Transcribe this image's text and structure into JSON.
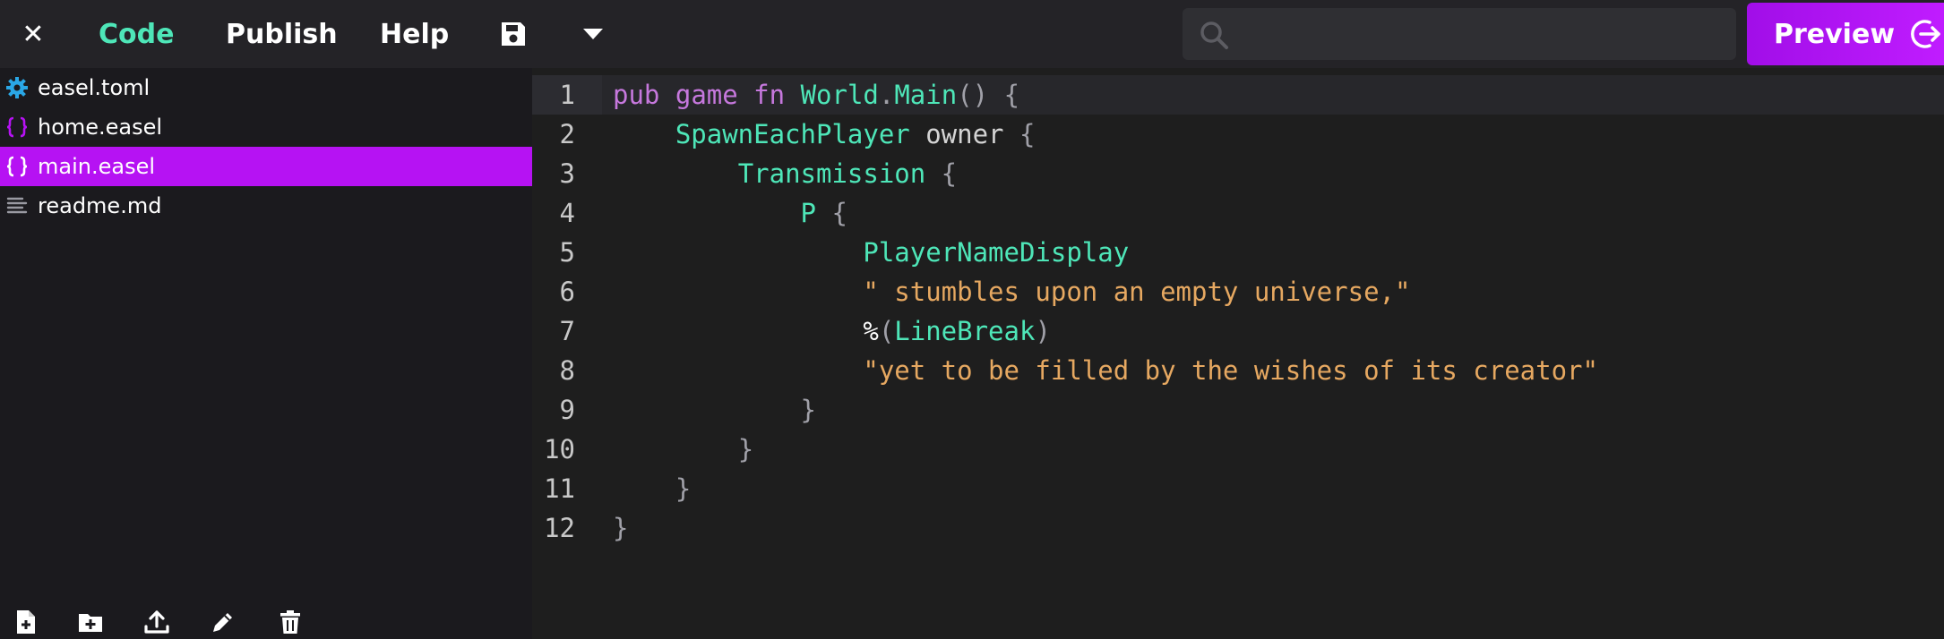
{
  "topbar": {
    "close_glyph": "✕",
    "tab_code": "Code",
    "tab_publish": "Publish",
    "tab_help": "Help",
    "search_placeholder": "",
    "preview_label": "Preview"
  },
  "icons": {
    "close": "close-icon",
    "save": "floppy-disk-icon",
    "dropdown": "caret-down-icon",
    "search": "search-icon",
    "preview": "exit-arrow-icon",
    "config": "gear-icon",
    "easel_file": "braces-icon",
    "markdown": "text-lines-icon"
  },
  "colors": {
    "accent": "#b612f3",
    "code_tab": "#4ee6b8",
    "keyword": "#c678dd",
    "identifier": "#4ee6b8",
    "string": "#e6a861"
  },
  "sidebar": {
    "files": [
      {
        "name": "easel.toml",
        "icon": "gear-icon",
        "active": false
      },
      {
        "name": "home.easel",
        "icon": "braces-icon",
        "active": false
      },
      {
        "name": "main.easel",
        "icon": "braces-icon",
        "active": true
      },
      {
        "name": "readme.md",
        "icon": "text-lines-icon",
        "active": false
      }
    ],
    "tools": [
      "new-file-icon",
      "new-folder-icon",
      "upload-icon",
      "pencil-icon",
      "trash-icon"
    ]
  },
  "editor": {
    "active_line": 1,
    "lines": [
      {
        "n": "1",
        "tokens": [
          [
            "kw",
            "pub"
          ],
          [
            "id",
            " "
          ],
          [
            "kw",
            "game"
          ],
          [
            "id",
            " "
          ],
          [
            "kw",
            "fn"
          ],
          [
            "id",
            " "
          ],
          [
            "fn",
            "World"
          ],
          [
            "pn",
            "."
          ],
          [
            "fn",
            "Main"
          ],
          [
            "pn",
            "()"
          ],
          [
            "id",
            " "
          ],
          [
            "pn",
            "{"
          ]
        ]
      },
      {
        "n": "2",
        "tokens": [
          [
            "id",
            "    "
          ],
          [
            "fn",
            "SpawnEachPlayer"
          ],
          [
            "id",
            " owner "
          ],
          [
            "pn",
            "{"
          ]
        ]
      },
      {
        "n": "3",
        "tokens": [
          [
            "id",
            "        "
          ],
          [
            "fn",
            "Transmission"
          ],
          [
            "id",
            " "
          ],
          [
            "pn",
            "{"
          ]
        ]
      },
      {
        "n": "4",
        "tokens": [
          [
            "id",
            "            "
          ],
          [
            "fn",
            "P"
          ],
          [
            "id",
            " "
          ],
          [
            "pn",
            "{"
          ]
        ]
      },
      {
        "n": "5",
        "tokens": [
          [
            "id",
            "                "
          ],
          [
            "fn",
            "PlayerNameDisplay"
          ]
        ]
      },
      {
        "n": "6",
        "tokens": [
          [
            "id",
            "                "
          ],
          [
            "st",
            "\" stumbles upon an empty universe,\""
          ]
        ]
      },
      {
        "n": "7",
        "tokens": [
          [
            "id",
            "                "
          ],
          [
            "op",
            "%"
          ],
          [
            "pn",
            "("
          ],
          [
            "fn",
            "LineBreak"
          ],
          [
            "pn",
            ")"
          ]
        ]
      },
      {
        "n": "8",
        "tokens": [
          [
            "id",
            "                "
          ],
          [
            "st",
            "\"yet to be filled by the wishes of its creator\""
          ]
        ]
      },
      {
        "n": "9",
        "tokens": [
          [
            "id",
            "            "
          ],
          [
            "pn",
            "}"
          ]
        ]
      },
      {
        "n": "10",
        "tokens": [
          [
            "id",
            "        "
          ],
          [
            "pn",
            "}"
          ]
        ]
      },
      {
        "n": "11",
        "tokens": [
          [
            "id",
            "    "
          ],
          [
            "pn",
            "}"
          ]
        ]
      },
      {
        "n": "12",
        "tokens": [
          [
            "pn",
            "}"
          ]
        ]
      }
    ]
  }
}
